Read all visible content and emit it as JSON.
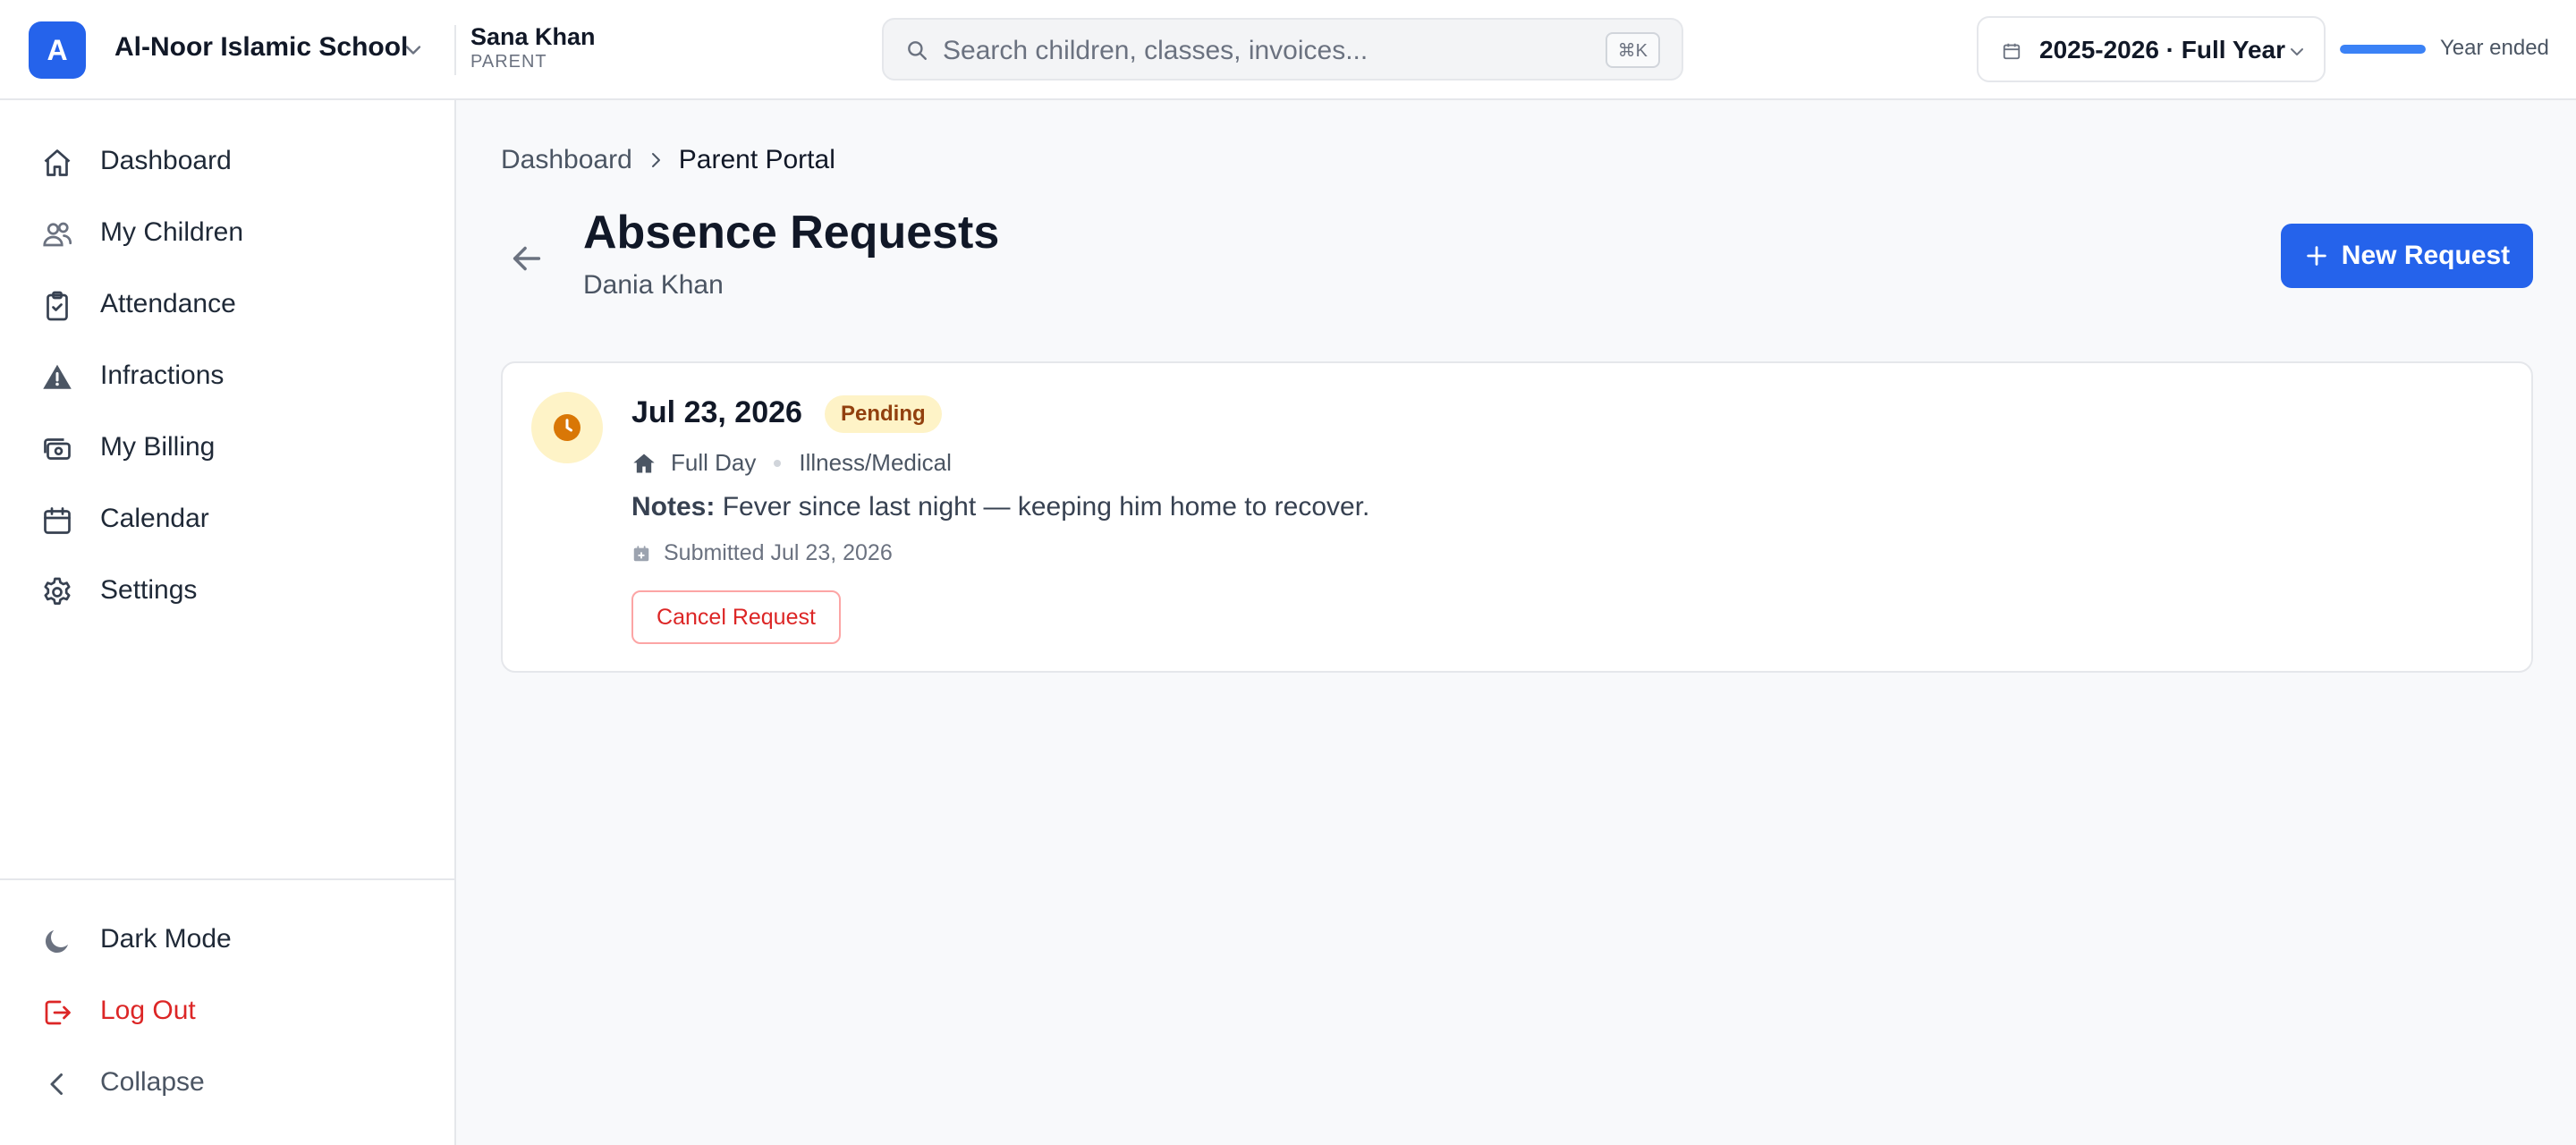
{
  "header": {
    "logo_letter": "A",
    "school_name": "Al-Noor Islamic School",
    "user_name": "Sana Khan",
    "user_role": "PARENT",
    "search_placeholder": "Search children, classes, invoices...",
    "search_shortcut": "⌘K",
    "year_label": "2025-2026 · Full Year",
    "year_status": "Year ended",
    "year_progress_percent": 100,
    "accent_color": "#2563eb"
  },
  "sidebar": {
    "items": [
      {
        "label": "Dashboard",
        "icon": "home-icon"
      },
      {
        "label": "My Children",
        "icon": "users-icon"
      },
      {
        "label": "Attendance",
        "icon": "clipboard-check-icon"
      },
      {
        "label": "Infractions",
        "icon": "warning-icon"
      },
      {
        "label": "My Billing",
        "icon": "cash-icon"
      },
      {
        "label": "Calendar",
        "icon": "calendar-icon"
      },
      {
        "label": "Settings",
        "icon": "gear-icon"
      }
    ],
    "bottom": [
      {
        "label": "Dark Mode",
        "icon": "moon-icon"
      },
      {
        "label": "Log Out",
        "icon": "logout-icon"
      },
      {
        "label": "Collapse",
        "icon": "chevron-left-icon"
      }
    ]
  },
  "breadcrumb": {
    "parent": "Dashboard",
    "current": "Parent Portal"
  },
  "page": {
    "title": "Absence Requests",
    "subtitle": "Dania Khan",
    "new_button": "New Request"
  },
  "requests": [
    {
      "date": "Jul 23, 2026",
      "status": "Pending",
      "duration": "Full Day",
      "reason": "Illness/Medical",
      "notes_label": "Notes:",
      "notes": "Fever since last night — keeping him home to recover.",
      "submitted": "Submitted Jul 23, 2026",
      "cancel_label": "Cancel Request"
    }
  ]
}
